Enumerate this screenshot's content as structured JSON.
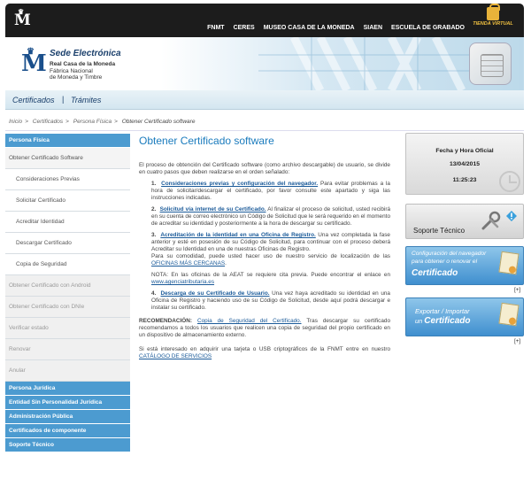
{
  "header": {
    "nav": [
      "FNMT",
      "CERES",
      "MUSEO CASA DE LA MONEDA",
      "SIAEN",
      "ESCUELA DE GRABADO"
    ],
    "shop_label": "TIENDA VIRTUAL"
  },
  "banner": {
    "site_title": "Sede Electrónica",
    "org_line1": "Real Casa de la Moneda",
    "org_line2": "Fábrica Nacional",
    "org_line3": "de Moneda y Timbre"
  },
  "tabs": {
    "certificados": "Certificados",
    "separator": "|",
    "tramites": "Trámites"
  },
  "breadcrumb": [
    "Inicio",
    "Certificados",
    "Persona Física",
    "Obtener Certificado software"
  ],
  "sidebar": {
    "header_persona_fisica": "Persona Física",
    "items": [
      "Obtener Certificado Software",
      "Consideraciones Previas",
      "Solicitar Certificado",
      "Acreditar Identidad",
      "Descargar Certificado",
      "Copia de Seguridad",
      "Obtener Certificado con Android",
      "Obtener Certificado con DNIe",
      "Verificar estado",
      "Renovar",
      "Anular"
    ],
    "sections": [
      "Persona Jurídica",
      "Entidad Sin Personalidad Jurídica",
      "Administración Pública",
      "Certificados de componente",
      "Soporte Técnico"
    ]
  },
  "main": {
    "title": "Obtener Certificado software",
    "intro": "El proceso de obtención del Certificado software (como archivo descargable) de usuario, se divide en cuatro pasos que deben realizarse en el orden señalado:",
    "step1_num": "1.",
    "step1_link": "Consideraciones previas y configuración del navegador.",
    "step1_text": " Para evitar problemas a la hora de solicitar/descargar el certificado, por favor consulte este apartado y siga las instrucciones indicadas.",
    "step2_num": "2.",
    "step2_link": "Solicitud vía internet de su Certificado.",
    "step2_text": " Al finalizar el proceso de solicitud, usted recibirá en su cuenta de correo electrónico un Código de Solicitud que le será requerido en el momento de acreditar su identidad y posteriormente a la hora de descargar su certificado.",
    "step3_num": "3.",
    "step3_link": "Acreditación de la identidad en una Oficina de Registro.",
    "step3_text": " Una vez completada la fase anterior y esté en posesión de su Código de Solicitud, para continuar con el proceso deberá Acreditar su Identidad en una de nuestras Oficinas de Registro.",
    "step3_extra": "Para su comodidad, puede usted hacer uso de nuestro servicio de localización de las ",
    "step3_extra_link": "OFICINAS MÁS CERCANAS",
    "step3_extra_end": ".",
    "note_text": "NOTA: En las oficinas de la AEAT se requiere cita previa. Puede encontrar el enlace en ",
    "note_link": "www.agenciatributaria.es",
    "step4_num": "4.",
    "step4_link": "Descarga de su Certificado de Usuario.",
    "step4_text": " Una vez haya acreditado su identidad en una Oficina de Registro y haciendo uso de su Código de Solicitud, desde aquí podrá descargar e instalar su certificado.",
    "reco_label": "RECOMENDACIÓN:",
    "reco_link": "Copia de Seguridad del Certificado.",
    "reco_text": " Tras descargar su certificado recomendamos a todos los usuarios que realicen una copia de seguridad del propio certificado en un dispositivo de almacenamiento externo.",
    "tarjeta_text": "Si está interesado en adquirir una tarjeta o USB criptográficos de la FNMT entre en nuestro ",
    "tarjeta_link": "CATÁLOGO DE SERVICIOS"
  },
  "right": {
    "clock_title": "Fecha y Hora Oficial",
    "date": "13/04/2015",
    "time": "11:25:23",
    "support_label": "Soporte Técnico",
    "config_l1": "Configuración del navegador",
    "config_l2": "para obtener o renovar el",
    "config_l3": "Certificado",
    "config_plus": "[+]",
    "export_l1": "Exportar / Importar",
    "export_l2_pre": "un ",
    "export_l2": "Certificado",
    "export_plus": "[+]"
  }
}
